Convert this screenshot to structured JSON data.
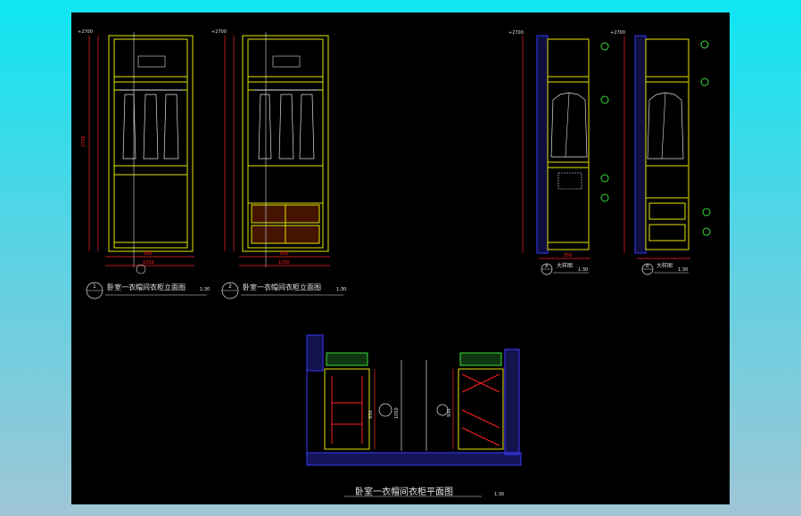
{
  "colors": {
    "background_top": "#0ee6f2",
    "background_bottom": "#9fc6d6",
    "drawing_background": "#000000",
    "frame": "#e6e600",
    "dimension": "#ff2020",
    "annotation": "#e0e0e0",
    "hatch": "#3a3aff",
    "section_green": "#3ddc3d",
    "drawer_fill": "#c23a00"
  },
  "drawing": {
    "elevation_1": {
      "number": "1",
      "title": "卧室一衣帽间衣柜立面图",
      "scale": "1:30",
      "top_level": "+2700",
      "dims": {
        "width_inner": "930",
        "width_total": "1050",
        "height": "2700"
      }
    },
    "elevation_2": {
      "number": "2",
      "title": "卧室一衣帽间衣柜立面图",
      "scale": "1:30",
      "top_level": "+2700",
      "dims": {
        "width_inner": "930",
        "width_total": "1050"
      }
    },
    "section_a": {
      "label": "A",
      "title": "大样图",
      "scale": "1:30",
      "top_level": "+2700",
      "dim": "550"
    },
    "section_b": {
      "label": "B",
      "title": "大样图",
      "scale": "1:30",
      "top_level": "+2700"
    },
    "plan": {
      "title": "卧室一衣帽间衣柜平面图",
      "scale": "1:30",
      "dims": {
        "depth_left": "930",
        "depth_left_total": "1050",
        "depth_right": "930"
      }
    }
  }
}
